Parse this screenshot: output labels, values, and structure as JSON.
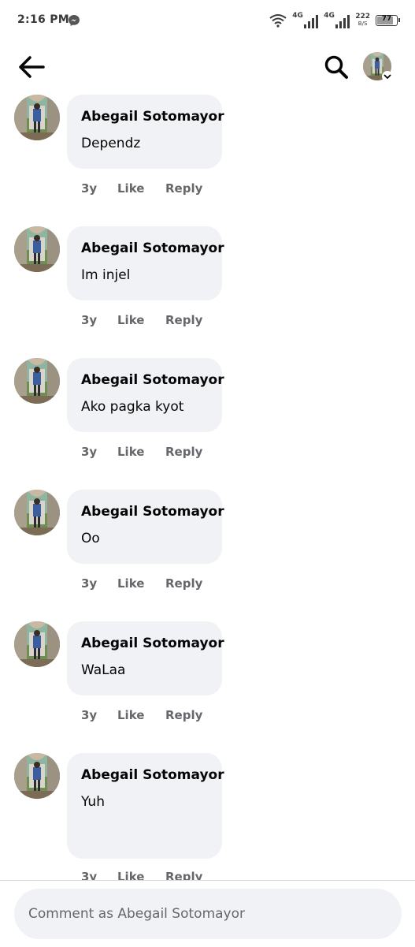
{
  "status_bar": {
    "time": "2:16 PM",
    "network_1": "4G",
    "network_2": "4G",
    "speed_value": "222",
    "speed_unit": "B/S",
    "battery": "77"
  },
  "header": {
    "back_icon": "arrow-left-icon",
    "search_icon": "search-icon"
  },
  "comments": [
    {
      "author": "Abegail Sotomayor",
      "text": "Dependz",
      "time": "3y",
      "like": "Like",
      "reply": "Reply"
    },
    {
      "author": "Abegail Sotomayor",
      "text": "Im injel",
      "time": "3y",
      "like": "Like",
      "reply": "Reply"
    },
    {
      "author": "Abegail Sotomayor",
      "text": "Ako pagka kyot",
      "time": "3y",
      "like": "Like",
      "reply": "Reply"
    },
    {
      "author": "Abegail Sotomayor",
      "text": "Oo",
      "time": "3y",
      "like": "Like",
      "reply": "Reply"
    },
    {
      "author": "Abegail Sotomayor",
      "text": "WaLaa",
      "time": "3y",
      "like": "Like",
      "reply": "Reply"
    },
    {
      "author": "Abegail Sotomayor",
      "text": "Yuh",
      "time": "3y",
      "like": "Like",
      "reply": "Reply"
    }
  ],
  "composer": {
    "placeholder": "Comment as Abegail Sotomayor"
  },
  "colors": {
    "bubble": "#f0f2f5",
    "meta_text": "#65676b",
    "primary_text": "#050505"
  }
}
